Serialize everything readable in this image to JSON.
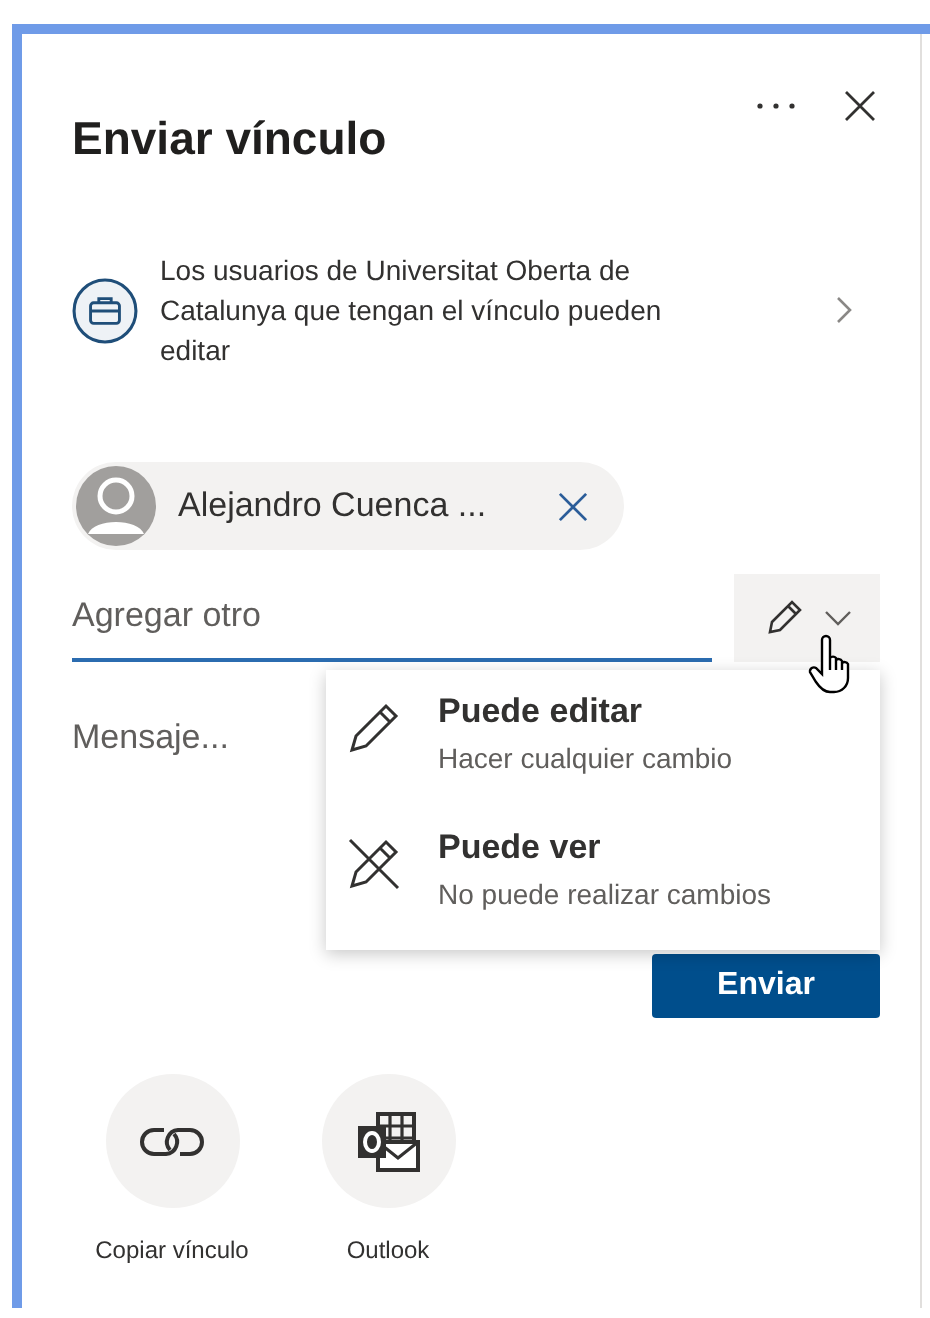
{
  "panel": {
    "title": "Enviar vínculo"
  },
  "link_settings": {
    "text": "Los usuarios de Universitat Oberta de Catalunya que tengan el vínculo pueden editar"
  },
  "recipient": {
    "name": "Alejandro Cuenca ..."
  },
  "add_field": {
    "placeholder": "Agregar otro"
  },
  "message_field": {
    "placeholder": "Mensaje..."
  },
  "permission_menu": {
    "expanded": true,
    "items": [
      {
        "kind": "edit",
        "title": "Puede editar",
        "description": "Hacer cualquier cambio"
      },
      {
        "kind": "view",
        "title": "Puede ver",
        "description": "No puede realizar cambios"
      }
    ]
  },
  "send_button": "Enviar",
  "share_options": [
    {
      "kind": "link",
      "label": "Copiar vínculo"
    },
    {
      "kind": "outlook",
      "label": "Outlook"
    }
  ]
}
